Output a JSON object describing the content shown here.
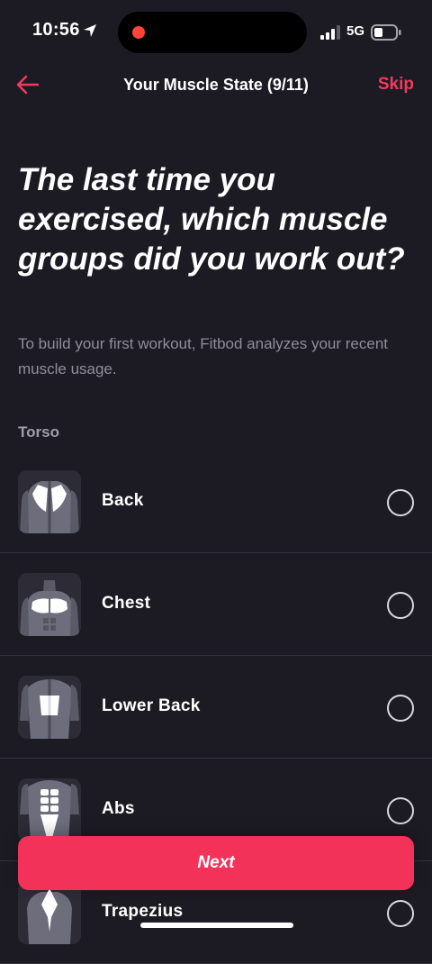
{
  "status_bar": {
    "time": "10:56",
    "network": "5G",
    "icons": [
      "location-arrow-icon",
      "recording-dot-icon",
      "cellular-signal-icon",
      "battery-icon"
    ]
  },
  "nav": {
    "title": "Your Muscle State (9/11)",
    "skip_label": "Skip",
    "back_icon": "back-arrow-icon"
  },
  "question": {
    "title": "The last time you exercised, which muscle groups did you work out?",
    "subtitle": "To build your first workout, Fitbod analyzes your recent muscle usage."
  },
  "section": {
    "label": "Torso"
  },
  "muscles": [
    {
      "label": "Back",
      "selected": false,
      "icon": "back-muscle-icon"
    },
    {
      "label": "Chest",
      "selected": false,
      "icon": "chest-muscle-icon"
    },
    {
      "label": "Lower Back",
      "selected": false,
      "icon": "lower-back-muscle-icon"
    },
    {
      "label": "Abs",
      "selected": false,
      "icon": "abs-muscle-icon"
    },
    {
      "label": "Trapezius",
      "selected": false,
      "icon": "trapezius-muscle-icon"
    }
  ],
  "footer": {
    "next_label": "Next"
  },
  "colors": {
    "background": "#1c1b24",
    "accent": "#f3325a",
    "secondary_text": "#8f8e99",
    "divider": "#34333d"
  }
}
